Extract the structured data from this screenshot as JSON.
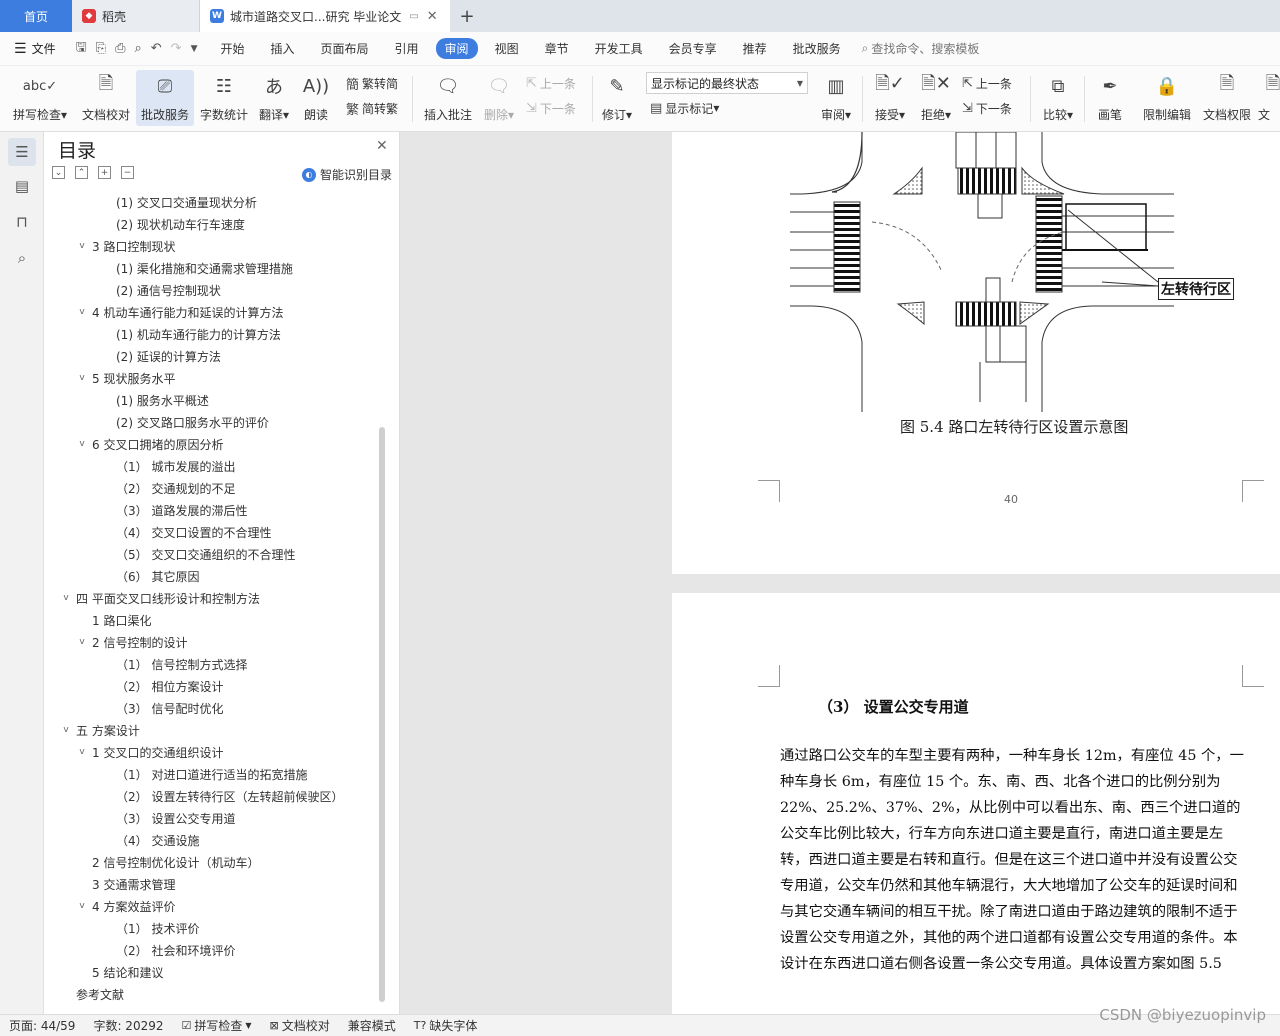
{
  "tabs": {
    "home": "首页",
    "daoke": "稻壳",
    "document": "城市道路交叉口...研究 毕业论文",
    "add": "+"
  },
  "menu": {
    "file": "文件",
    "items": [
      "开始",
      "插入",
      "页面布局",
      "引用",
      "审阅",
      "视图",
      "章节",
      "开发工具",
      "会员专享",
      "推荐",
      "批改服务"
    ],
    "active": "审阅",
    "search": "查找命令、搜索模板"
  },
  "ribbon": {
    "spellcheck": "拼写检查",
    "doc_proof": "文档校对",
    "grading": "批改服务",
    "word_count": "字数统计",
    "translate": "翻译",
    "read_aloud": "朗读",
    "trad_to_simp": "繁转简",
    "simp_to_trad": "简转繁",
    "insert_comment": "插入批注",
    "delete": "删除",
    "prev_comment": "上一条",
    "next_comment": "下一条",
    "track": "修订",
    "markup_state": "显示标记的最终状态",
    "show_markup": "显示标记",
    "review": "审阅",
    "accept": "接受",
    "reject": "拒绝",
    "prev_change": "上一条",
    "next_change": "下一条",
    "compare": "比较",
    "ink": "画笔",
    "restrict_edit": "限制编辑",
    "doc_permission": "文档权限",
    "doc_more": "文"
  },
  "toc": {
    "title": "目录",
    "smart": "智能识别目录",
    "items": [
      {
        "text": "(1)  交叉口交通量现状分析",
        "level": 3,
        "toggle": ""
      },
      {
        "text": "(2)  现状机动车行车速度",
        "level": 3,
        "toggle": ""
      },
      {
        "text": "3  路口控制现状",
        "level": 2,
        "toggle": "v"
      },
      {
        "text": "(1)  渠化措施和交通需求管理措施",
        "level": 3,
        "toggle": ""
      },
      {
        "text": "(2)  通信号控制现状",
        "level": 3,
        "toggle": ""
      },
      {
        "text": "4  机动车通行能力和延误的计算方法",
        "level": 2,
        "toggle": "v"
      },
      {
        "text": "(1)  机动车通行能力的计算方法",
        "level": 3,
        "toggle": ""
      },
      {
        "text": "(2)  延误的计算方法",
        "level": 3,
        "toggle": ""
      },
      {
        "text": "5  现状服务水平",
        "level": 2,
        "toggle": "v"
      },
      {
        "text": "(1)  服务水平概述",
        "level": 3,
        "toggle": ""
      },
      {
        "text": "(2)  交叉路口服务水平的评价",
        "level": 3,
        "toggle": ""
      },
      {
        "text": "6  交叉口拥堵的原因分析",
        "level": 2,
        "toggle": "v"
      },
      {
        "text": "（1）  城市发展的溢出",
        "level": 3,
        "toggle": ""
      },
      {
        "text": "（2）  交通规划的不足",
        "level": 3,
        "toggle": ""
      },
      {
        "text": "（3）  道路发展的滞后性",
        "level": 3,
        "toggle": ""
      },
      {
        "text": "（4）  交叉口设置的不合理性",
        "level": 3,
        "toggle": ""
      },
      {
        "text": "（5）  交叉口交通组织的不合理性",
        "level": 3,
        "toggle": ""
      },
      {
        "text": "（6）  其它原因",
        "level": 3,
        "toggle": ""
      },
      {
        "text": "四  平面交叉口线形设计和控制方法",
        "level": 1,
        "toggle": "v"
      },
      {
        "text": "1  路口渠化",
        "level": 2,
        "toggle": ""
      },
      {
        "text": "2  信号控制的设计",
        "level": 2,
        "toggle": "v"
      },
      {
        "text": "（1）  信号控制方式选择",
        "level": 3,
        "toggle": ""
      },
      {
        "text": "（2）  相位方案设计",
        "level": 3,
        "toggle": ""
      },
      {
        "text": "（3）  信号配时优化",
        "level": 3,
        "toggle": ""
      },
      {
        "text": "五  方案设计",
        "level": 1,
        "toggle": "v"
      },
      {
        "text": "1  交叉口的交通组织设计",
        "level": 2,
        "toggle": "v"
      },
      {
        "text": "（1）  对进口道进行适当的拓宽措施",
        "level": 3,
        "toggle": ""
      },
      {
        "text": "（2）  设置左转待行区（左转超前候驶区）",
        "level": 3,
        "toggle": ""
      },
      {
        "text": "（3）  设置公交专用道",
        "level": 3,
        "toggle": ""
      },
      {
        "text": "（4）  交通设施",
        "level": 3,
        "toggle": ""
      },
      {
        "text": "2  信号控制优化设计（机动车）",
        "level": 2,
        "toggle": ""
      },
      {
        "text": "3  交通需求管理",
        "level": 2,
        "toggle": ""
      },
      {
        "text": "4  方案效益评价",
        "level": 2,
        "toggle": "v"
      },
      {
        "text": "（1）  技术评价",
        "level": 3,
        "toggle": ""
      },
      {
        "text": "（2）  社会和环境评价",
        "level": 3,
        "toggle": ""
      },
      {
        "text": "5  结论和建议",
        "level": 2,
        "toggle": ""
      },
      {
        "text": "参考文献",
        "level": 1,
        "toggle": ""
      }
    ]
  },
  "document": {
    "figure_label": "左转待行区",
    "figure_caption": "图 5.4   路口左转待行区设置示意图",
    "page_number": "40",
    "heading": "（3）  设置公交专用道",
    "paragraph": "通过路口公交车的车型主要有两种，一种车身长 12m，有座位 45 个，一种车身长 6m，有座位 15 个。东、南、西、北各个进口的比例分别为 22%、25.2%、37%、2%，从比例中可以看出东、南、西三个进口道的公交车比例比较大，行车方向东进口道主要是直行，南进口道主要是左转，西进口道主要是右转和直行。但是在这三个进口道中并没有设置公交专用道，公交车仍然和其他车辆混行，大大地增加了公交车的延误时间和与其它交通车辆间的相互干扰。除了南进口道由于路边建筑的限制不适于设置公交专用道之外，其他的两个进口道都有设置公交专用道的条件。本设计在东西进口道右侧各设置一条公交专用道。具体设置方案如图 5.5"
  },
  "status": {
    "page": "页面: 44/59",
    "words": "字数: 20292",
    "spellcheck": "拼写检查",
    "doc_proof": "文档校对",
    "compat": "兼容模式",
    "missing_font": "缺失字体"
  },
  "watermark": "CSDN @biyezuopinvip",
  "colors": {
    "accent": "#3d7de0",
    "daoke_logo": "#e0393e"
  }
}
